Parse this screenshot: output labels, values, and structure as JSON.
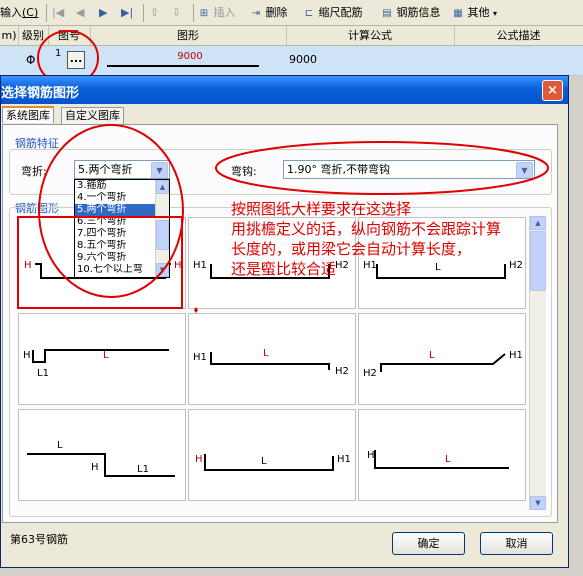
{
  "toolbar": {
    "input_label": "输入",
    "input_shortcut": "(C)",
    "insert_label": "插入",
    "delete_label": "删除",
    "scale_label": "缩尺配筋",
    "rebar_info_label": "钢筋信息",
    "other_label": "其他"
  },
  "grid": {
    "headers": [
      "m)",
      "级别",
      "图号",
      "图形",
      "计算公式",
      "公式描述"
    ],
    "row": {
      "grade_symbol": "Φ",
      "figure_no": "1",
      "button": "...",
      "shape_value": "9000",
      "formula": "9000"
    }
  },
  "dialog": {
    "title": "选择钢筋图形",
    "close": "×",
    "tabs": [
      "系统图库",
      "自定义图库"
    ],
    "features_label": "钢筋特征",
    "bend_label": "弯折:",
    "bend_value": "5.两个弯折",
    "hook_label": "弯钩:",
    "hook_value": "1.90° 弯折,不带弯钩",
    "bend_options": [
      "3.箍筋",
      "4.一个弯折",
      "5.两个弯折",
      "6.三个弯折",
      "7.四个弯折",
      "8.五个弯折",
      "9.六个弯折",
      "10.七个以上弯"
    ],
    "bend_selected_index": 2,
    "shapes_label": "钢筋图形",
    "status": "第63号钢筋",
    "ok_label": "确定",
    "cancel_label": "取消"
  },
  "shapes": [
    {
      "labels": [
        "H",
        "L",
        "H"
      ]
    },
    {
      "labels": [
        "H1",
        "L",
        "H2"
      ]
    },
    {
      "labels": [
        "H1",
        "L",
        "H2"
      ]
    },
    {
      "labels": [
        "H",
        "L",
        "L1"
      ]
    },
    {
      "labels": [
        "H1",
        "L",
        "H2"
      ]
    },
    {
      "labels": [
        "H2",
        "L",
        "H1"
      ]
    },
    {
      "labels": [
        "L",
        "H",
        "L1"
      ]
    },
    {
      "labels": [
        "H",
        "L",
        "H1"
      ]
    },
    {
      "labels": [
        "H",
        "L"
      ]
    }
  ],
  "annotation": {
    "lines": [
      "按照图纸大样要求在这选择",
      "用挑檐定义的话，纵向钢筋不会跟踪计算",
      "长度的，或用梁它会自动计算长度，",
      "还是蛮比较合适"
    ]
  },
  "colors": {
    "annotation": "#e00000",
    "title_bar": "#0a5fd8",
    "selection": "#316ac5"
  }
}
